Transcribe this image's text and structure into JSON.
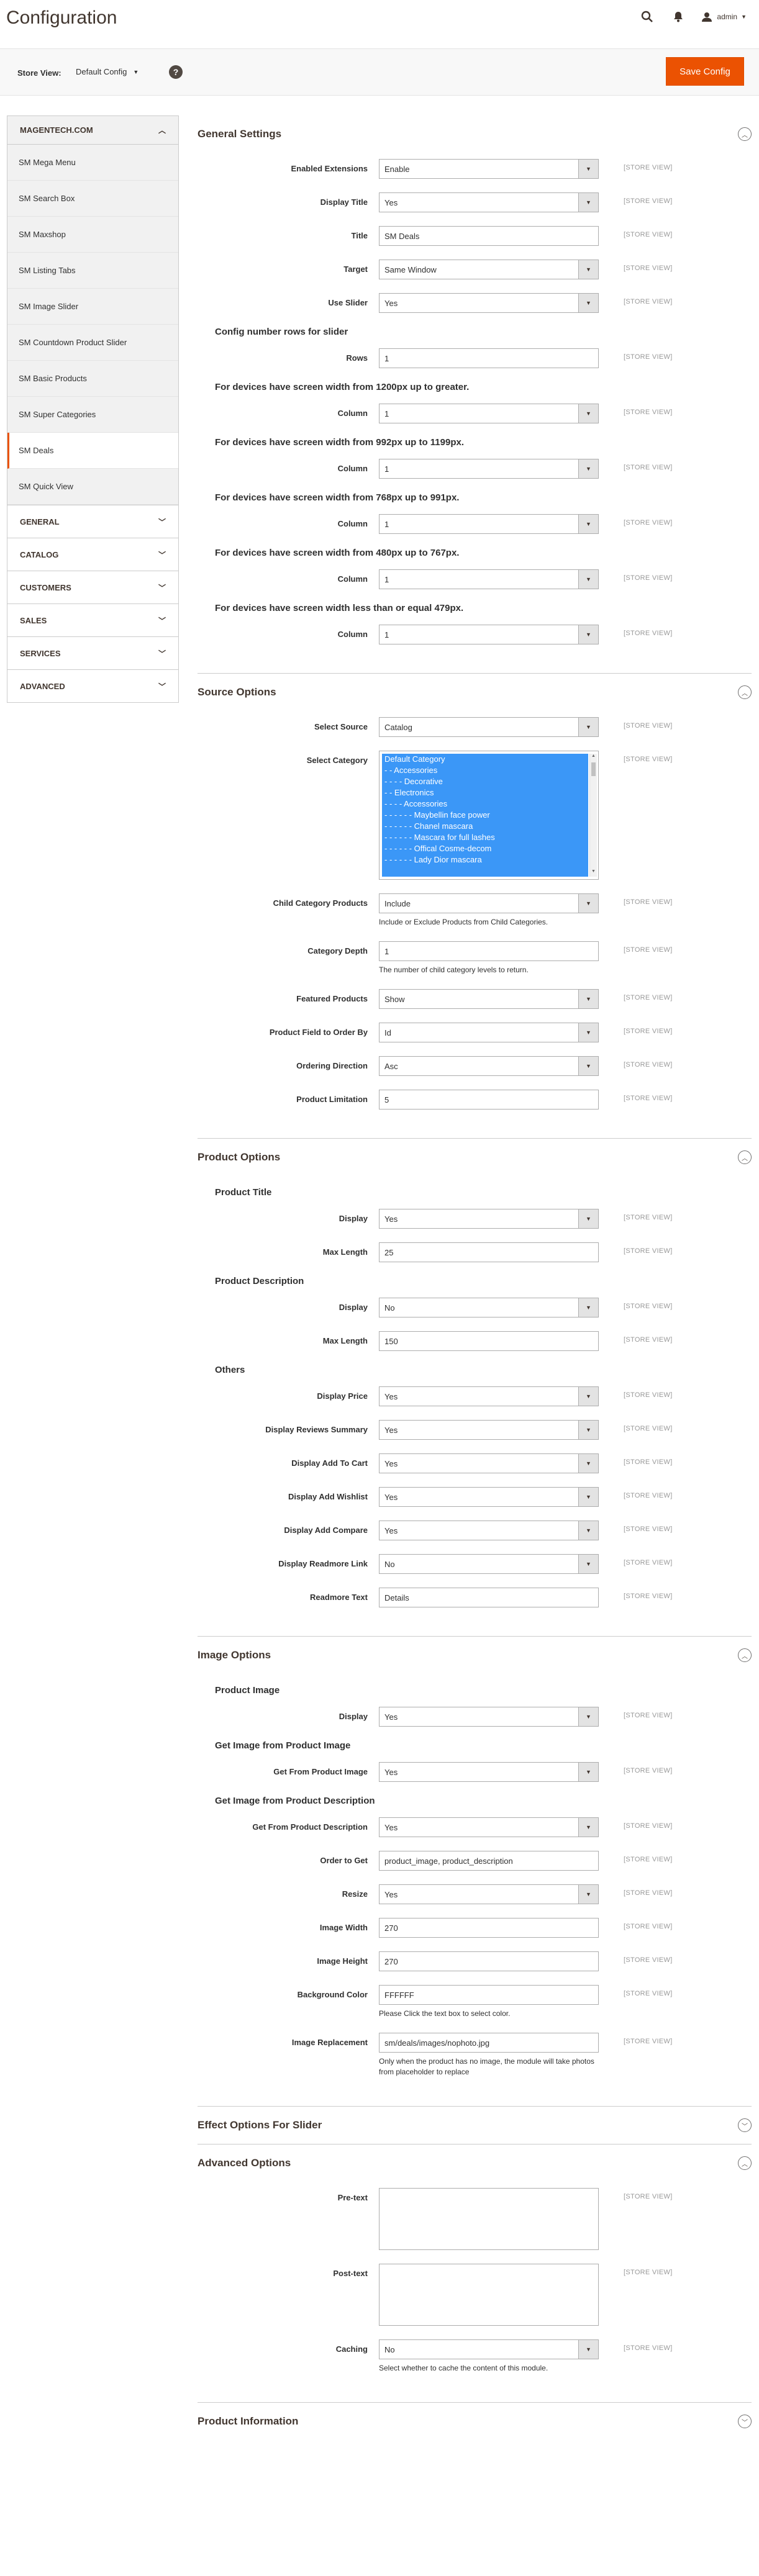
{
  "header": {
    "title": "Configuration",
    "admin_label": "admin"
  },
  "scope": {
    "label": "Store View:",
    "value": "Default Config",
    "help": "?",
    "save_label": "Save Config"
  },
  "sidebar": {
    "head": "MAGENTECH.COM",
    "items": [
      "SM Mega Menu",
      "SM Search Box",
      "SM Maxshop",
      "SM Listing Tabs",
      "SM Image Slider",
      "SM Countdown Product Slider",
      "SM Basic Products",
      "SM Super Categories",
      "SM Deals",
      "SM Quick View"
    ],
    "active_item": "SM Deals",
    "groups": [
      "GENERAL",
      "CATALOG",
      "CUSTOMERS",
      "SALES",
      "SERVICES",
      "ADVANCED"
    ]
  },
  "scope_tag": "[STORE VIEW]",
  "general": {
    "title": "General Settings",
    "enabled": {
      "label": "Enabled Extensions",
      "value": "Enable"
    },
    "display_title": {
      "label": "Display Title",
      "value": "Yes"
    },
    "title_field": {
      "label": "Title",
      "value": "SM Deals"
    },
    "target": {
      "label": "Target",
      "value": "Same Window"
    },
    "use_slider": {
      "label": "Use Slider",
      "value": "Yes"
    },
    "rows_heading": "Config number rows for slider",
    "rows": {
      "label": "Rows",
      "value": "1"
    },
    "devices": [
      {
        "heading": "For devices have screen width from 1200px up to greater.",
        "label": "Column",
        "value": "1"
      },
      {
        "heading": "For devices have screen width from 992px up to 1199px.",
        "label": "Column",
        "value": "1"
      },
      {
        "heading": "For devices have screen width from 768px up to 991px.",
        "label": "Column",
        "value": "1"
      },
      {
        "heading": "For devices have screen width from 480px up to 767px.",
        "label": "Column",
        "value": "1"
      },
      {
        "heading": "For devices have screen width less than or equal 479px.",
        "label": "Column",
        "value": "1"
      }
    ]
  },
  "source": {
    "title": "Source Options",
    "select_source": {
      "label": "Select Source",
      "value": "Catalog"
    },
    "select_category": {
      "label": "Select Category",
      "options": [
        "Default Category",
        "- - Accessories",
        "- - - - Decorative",
        "- - Electronics",
        "- - - - Accessories",
        "- - - - - - Maybellin face power",
        "- - - - - - Chanel mascara",
        "- - - - - - Mascara for full lashes",
        "- - - - - - Offical Cosme-decom",
        "- - - - - - Lady Dior mascara"
      ]
    },
    "child_products": {
      "label": "Child Category Products",
      "value": "Include",
      "note": "Include or Exclude Products from Child Categories."
    },
    "depth": {
      "label": "Category Depth",
      "value": "1",
      "note": "The number of child category levels to return."
    },
    "featured": {
      "label": "Featured Products",
      "value": "Show"
    },
    "order_by": {
      "label": "Product Field to Order By",
      "value": "Id"
    },
    "direction": {
      "label": "Ordering Direction",
      "value": "Asc"
    },
    "limitation": {
      "label": "Product Limitation",
      "value": "5"
    }
  },
  "product": {
    "title": "Product Options",
    "title_heading": "Product Title",
    "title_display": {
      "label": "Display",
      "value": "Yes"
    },
    "title_max": {
      "label": "Max Length",
      "value": "25"
    },
    "desc_heading": "Product Description",
    "desc_display": {
      "label": "Display",
      "value": "No"
    },
    "desc_max": {
      "label": "Max Length",
      "value": "150"
    },
    "others_heading": "Others",
    "price": {
      "label": "Display Price",
      "value": "Yes"
    },
    "reviews": {
      "label": "Display Reviews Summary",
      "value": "Yes"
    },
    "cart": {
      "label": "Display Add To Cart",
      "value": "Yes"
    },
    "wishlist": {
      "label": "Display Add Wishlist",
      "value": "Yes"
    },
    "compare": {
      "label": "Display Add Compare",
      "value": "Yes"
    },
    "readmore": {
      "label": "Display Readmore Link",
      "value": "No"
    },
    "readmore_text": {
      "label": "Readmore Text",
      "value": "Details"
    }
  },
  "image": {
    "title": "Image Options",
    "product_image_heading": "Product Image",
    "display": {
      "label": "Display",
      "value": "Yes"
    },
    "from_image_heading": "Get Image from Product Image",
    "from_image": {
      "label": "Get From Product Image",
      "value": "Yes"
    },
    "from_desc_heading": "Get Image from Product Description",
    "from_desc": {
      "label": "Get From Product Description",
      "value": "Yes"
    },
    "order": {
      "label": "Order to Get",
      "value": "product_image, product_description"
    },
    "resize": {
      "label": "Resize",
      "value": "Yes"
    },
    "width": {
      "label": "Image Width",
      "value": "270"
    },
    "height": {
      "label": "Image Height",
      "value": "270"
    },
    "bg": {
      "label": "Background Color",
      "value": "FFFFFF",
      "note": "Please Click the text box to select color."
    },
    "replacement": {
      "label": "Image Replacement",
      "value": "sm/deals/images/nophoto.jpg",
      "note": "Only when the product has no image, the module will take photos from placeholder to replace"
    }
  },
  "effect": {
    "title": "Effect Options For Slider"
  },
  "advanced": {
    "title": "Advanced Options",
    "pre_text": {
      "label": "Pre-text"
    },
    "post_text": {
      "label": "Post-text"
    },
    "caching": {
      "label": "Caching",
      "value": "No",
      "note": "Select whether to cache the content of this module."
    }
  },
  "info": {
    "title": "Product Information"
  }
}
